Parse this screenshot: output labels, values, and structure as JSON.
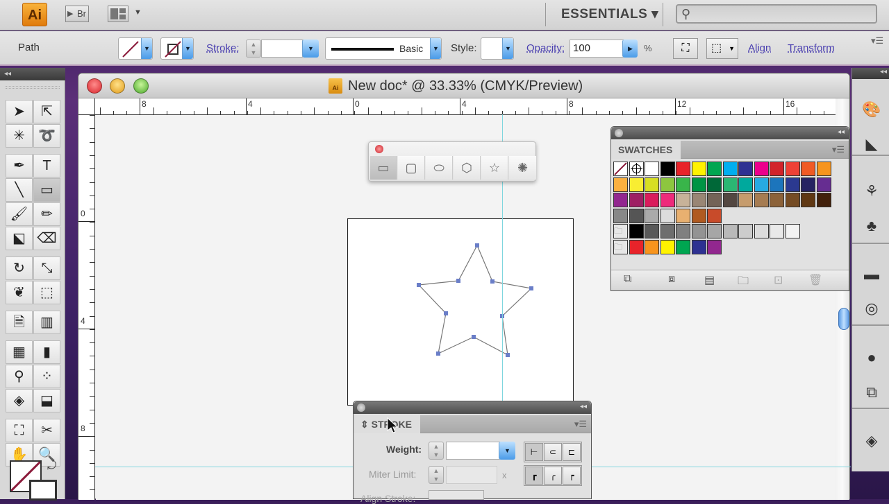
{
  "app": {
    "logo": "Ai",
    "bridge_label": "Br",
    "workspace": "ESSENTIALS ▾",
    "search_placeholder": ""
  },
  "control_bar": {
    "selection_type": "Path",
    "stroke_label": "Stroke:",
    "stroke_value": "",
    "brush_label": "Basic",
    "style_label": "Style:",
    "opacity_label": "Opacity:",
    "opacity_value": "100",
    "opacity_unit": "%",
    "align_link": "Align",
    "transform_link": "Transform"
  },
  "tools": [
    {
      "name": "selection-tool",
      "glyph": "➤"
    },
    {
      "name": "direct-selection-tool",
      "glyph": "⇱"
    },
    {
      "name": "magic-wand-tool",
      "glyph": "✳"
    },
    {
      "name": "lasso-tool",
      "glyph": "➰"
    },
    {
      "name": "pen-tool",
      "glyph": "✒"
    },
    {
      "name": "type-tool",
      "glyph": "T"
    },
    {
      "name": "line-segment-tool",
      "glyph": "╲"
    },
    {
      "name": "rectangle-tool",
      "glyph": "▭",
      "selected": true
    },
    {
      "name": "paintbrush-tool",
      "glyph": "🖌"
    },
    {
      "name": "pencil-tool",
      "glyph": "✏"
    },
    {
      "name": "blob-brush-tool",
      "glyph": "⬕"
    },
    {
      "name": "eraser-tool",
      "glyph": "⌫"
    },
    {
      "name": "rotate-tool",
      "glyph": "↻"
    },
    {
      "name": "scale-tool",
      "glyph": "⤡"
    },
    {
      "name": "warp-tool",
      "glyph": "❦"
    },
    {
      "name": "free-transform-tool",
      "glyph": "⬚"
    },
    {
      "name": "symbol-sprayer-tool",
      "glyph": "🗎"
    },
    {
      "name": "column-graph-tool",
      "glyph": "▥"
    },
    {
      "name": "mesh-tool",
      "glyph": "▦"
    },
    {
      "name": "gradient-tool",
      "glyph": "▮"
    },
    {
      "name": "eyedropper-tool",
      "glyph": "⚲"
    },
    {
      "name": "blend-tool",
      "glyph": "⁘"
    },
    {
      "name": "live-paint-bucket-tool",
      "glyph": "◈"
    },
    {
      "name": "live-paint-selection-tool",
      "glyph": "⬓"
    },
    {
      "name": "artboard-tool",
      "glyph": "⛶"
    },
    {
      "name": "slice-tool",
      "glyph": "✂"
    },
    {
      "name": "hand-tool",
      "glyph": "✋"
    },
    {
      "name": "zoom-tool",
      "glyph": "🔍"
    }
  ],
  "document": {
    "title": "New doc* @ 33.33% (CMYK/Preview)",
    "hruler_labels": [
      "8",
      "4",
      "0",
      "4",
      "8",
      "12",
      "16"
    ],
    "vruler_labels": [
      "0",
      "4",
      "8"
    ]
  },
  "shape_toolbar": {
    "items": [
      "rectangle",
      "rounded-rectangle",
      "ellipse",
      "polygon",
      "star",
      "flare"
    ]
  },
  "swatches": {
    "title": "SWATCHES",
    "row1": [
      "none",
      "registration",
      "#ffffff",
      "#000000",
      "#e8232a",
      "#fff200",
      "#00a651",
      "#00aeef",
      "#2e3192",
      "#ec008c",
      "#d2232a",
      "#ef4136",
      "#f15a24",
      "#f7941d"
    ],
    "row2": [
      "#fbb040",
      "#f9ed32",
      "#d7df23",
      "#8dc63f",
      "#39b54a",
      "#009444",
      "#006838",
      "#2bb673",
      "#00a99d",
      "#27aae1",
      "#1c75bc",
      "#2b3990",
      "#262262",
      "#662d91"
    ],
    "row3": [
      "#92278f",
      "#9e1f63",
      "#da1c5c",
      "#ee2a7b",
      "#c7b299",
      "#998675",
      "#736357",
      "#534741",
      "#c69c6d",
      "#a67c52",
      "#8c6239",
      "#754c24",
      "#603813",
      "#42210b"
    ],
    "gradients": [
      "#888",
      "#555",
      "#aaa",
      "#ddd",
      "#e8b070",
      "#b05a20",
      "#c84b2a"
    ],
    "grays": [
      "#000000",
      "#595959",
      "#6e6e6e",
      "#808080",
      "#939393",
      "#a6a6a6",
      "#b9b9b9",
      "#cccccc",
      "#dcdcdc",
      "#e9e9e9",
      "#f3f3f3"
    ],
    "brights": [
      "#e8232a",
      "#f7941d",
      "#fff200",
      "#00a651",
      "#2e3192",
      "#92278f"
    ]
  },
  "stroke_panel": {
    "title": "STROKE",
    "weight_label": "Weight:",
    "weight_value": "",
    "miter_label": "Miter Limit:",
    "miter_unit": "x",
    "align_label": "Align Stroke:"
  },
  "right_dock": [
    "color-icon",
    "color-guide-icon",
    "brushes-icon",
    "symbols-icon",
    "stroke-gradient-icon",
    "transparency-icon",
    "appearance-icon",
    "graphic-styles-icon",
    "layers-icon"
  ]
}
